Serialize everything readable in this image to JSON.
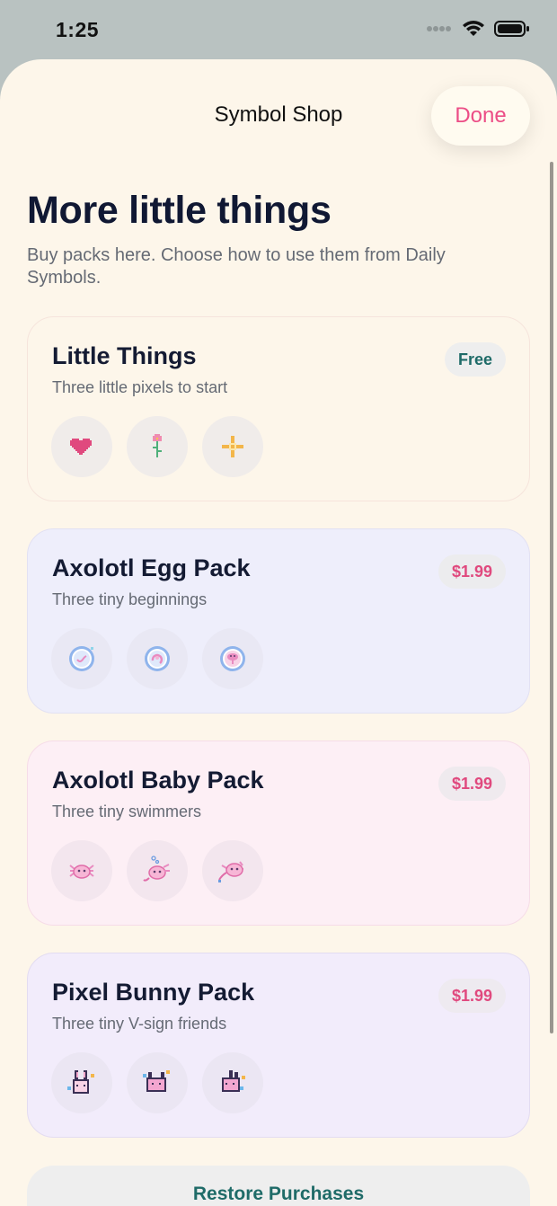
{
  "status": {
    "time": "1:25"
  },
  "nav": {
    "title": "Symbol Shop",
    "done_label": "Done"
  },
  "header": {
    "title": "More little things",
    "subtitle": "Buy packs here. Choose how to use them from Daily Symbols."
  },
  "packs": [
    {
      "name": "Little Things",
      "description": "Three little pixels to start",
      "price": "Free",
      "icons": [
        "pixel-heart-icon",
        "pixel-flower-icon",
        "pixel-sparkle-icon"
      ]
    },
    {
      "name": "Axolotl Egg Pack",
      "description": "Three tiny beginnings",
      "price": "$1.99",
      "icons": [
        "axolotl-egg-icon",
        "axolotl-egg-curled-icon",
        "axolotl-egg-hatching-icon"
      ]
    },
    {
      "name": "Axolotl Baby Pack",
      "description": "Three tiny swimmers",
      "price": "$1.99",
      "icons": [
        "axolotl-baby-icon",
        "axolotl-baby-bubbles-icon",
        "axolotl-baby-swim-icon"
      ]
    },
    {
      "name": "Pixel Bunny Pack",
      "description": "Three tiny V-sign friends",
      "price": "$1.99",
      "icons": [
        "pixel-bunny-icon",
        "pixel-bunny-box-icon",
        "pixel-bunny-peek-icon"
      ]
    }
  ],
  "restore_label": "Restore Purchases",
  "colors": {
    "accent": "#ec4d86",
    "sheet_background": "#fdf6ea",
    "free_badge_text": "#1f6b68",
    "price_badge_text": "#e0497e"
  }
}
